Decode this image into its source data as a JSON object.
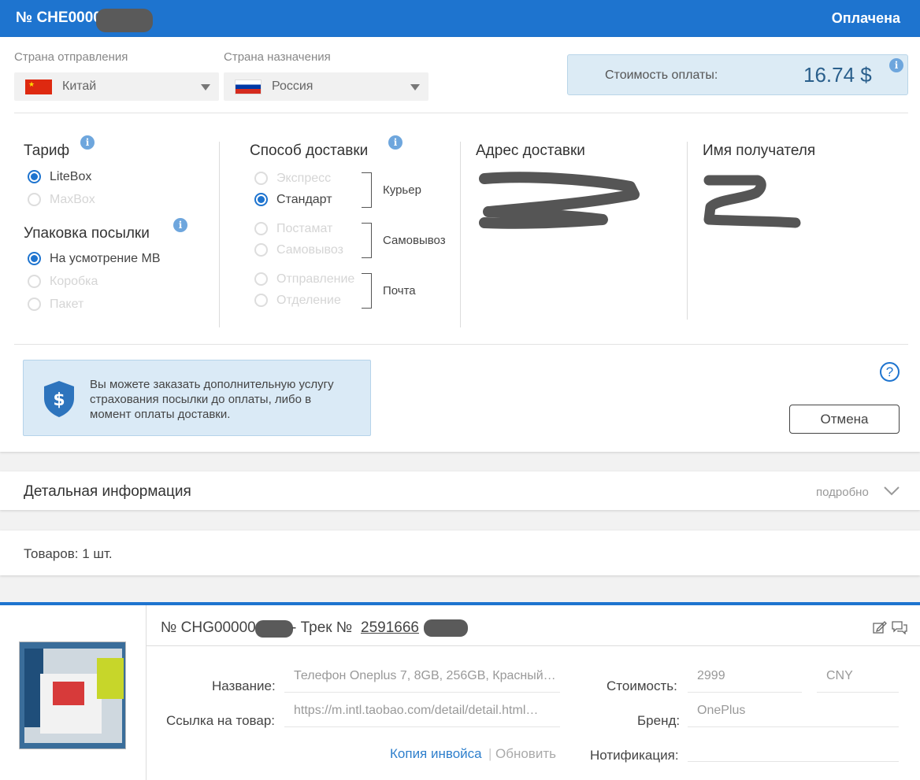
{
  "header": {
    "number": "№ CHE0000",
    "status": "Оплачена"
  },
  "route": {
    "origin_label": "Страна отправления",
    "origin_value": "Китай",
    "destination_label": "Страна назначения",
    "destination_value": "Россия"
  },
  "payment": {
    "label": "Стоимость оплаты:",
    "value": "16.74 $"
  },
  "tariff": {
    "title": "Тариф",
    "options": [
      {
        "label": "LiteBox",
        "selected": true
      },
      {
        "label": "MaxBox",
        "selected": false
      }
    ]
  },
  "packaging": {
    "title": "Упаковка посылки",
    "options": [
      {
        "label": "На усмотрение MB",
        "selected": true
      },
      {
        "label": "Коробка",
        "selected": false
      },
      {
        "label": "Пакет",
        "selected": false
      }
    ]
  },
  "delivery": {
    "title": "Способ доставки",
    "groups": [
      {
        "label": "Курьер",
        "options": [
          {
            "label": "Экспресс",
            "selected": false
          },
          {
            "label": "Стандарт",
            "selected": true
          }
        ]
      },
      {
        "label": "Самовывоз",
        "options": [
          {
            "label": "Постамат",
            "selected": false
          },
          {
            "label": "Самовывоз",
            "selected": false
          }
        ]
      },
      {
        "label": "Почта",
        "options": [
          {
            "label": "Отправление",
            "selected": false
          },
          {
            "label": "Отделение",
            "selected": false
          }
        ]
      }
    ]
  },
  "address": {
    "title": "Адрес доставки"
  },
  "recipient": {
    "title": "Имя получателя"
  },
  "insurance": {
    "text": "Вы можете заказать дополнительную услугу страхования посылки до оплаты, либо в момент оплаты доставки."
  },
  "actions": {
    "help": "?",
    "cancel": "Отмена"
  },
  "details": {
    "title": "Детальная информация",
    "more": "подробно"
  },
  "goods": {
    "count_text": "Товаров: 1 шт."
  },
  "item": {
    "number": "№ CHG00000",
    "track_prefix": " - Трек № ",
    "track": "2591666",
    "name_label": "Название:",
    "name_value": "Телефон Oneplus 7, 8GB, 256GB, Красный…",
    "link_label": "Ссылка на товар:",
    "link_value": "https://m.intl.taobao.com/detail/detail.html…",
    "invoice_link": "Копия инвойса",
    "separator": "|",
    "refresh_link": "Обновить",
    "cost_label": "Стоимость:",
    "cost_value": "2999",
    "currency": "CNY",
    "brand_label": "Бренд:",
    "brand_value": "OnePlus",
    "notification_label": "Нотификация:",
    "notification_value": ""
  },
  "colors": {
    "accent": "#1e74cf",
    "info_bg": "#dcebf5"
  }
}
